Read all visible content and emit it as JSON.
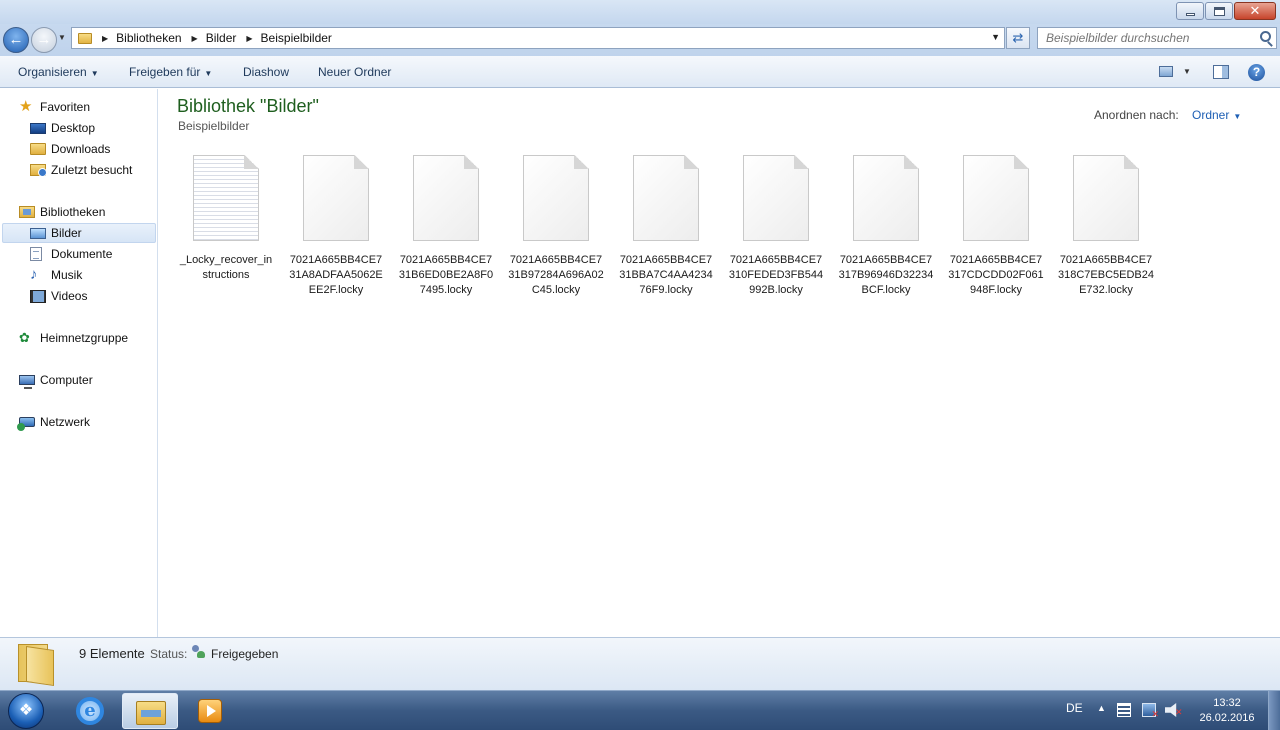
{
  "window": {
    "close_glyph": "✕"
  },
  "address": {
    "breadcrumbs": [
      "Bibliotheken",
      "Bilder",
      "Beispielbilder"
    ],
    "search_placeholder": "Beispielbilder durchsuchen"
  },
  "toolbar": {
    "organize": "Organisieren",
    "share": "Freigeben für",
    "slideshow": "Diashow",
    "new_folder": "Neuer Ordner",
    "help": "?"
  },
  "sidebar": {
    "favorites": "Favoriten",
    "desktop": "Desktop",
    "downloads": "Downloads",
    "recent": "Zuletzt besucht",
    "libraries": "Bibliotheken",
    "pictures": "Bilder",
    "documents": "Dokumente",
    "music": "Musik",
    "videos": "Videos",
    "homegroup": "Heimnetzgruppe",
    "computer": "Computer",
    "network": "Netzwerk"
  },
  "content": {
    "title": "Bibliothek \"Bilder\"",
    "subtitle": "Beispielbilder",
    "arrange_label": "Anordnen nach:",
    "arrange_value": "Ordner",
    "files": [
      {
        "name": "_Locky_recover_instructions",
        "type": "text"
      },
      {
        "name": "7021A665BB4CE731A8ADFAA5062EEE2F.locky",
        "type": "blank"
      },
      {
        "name": "7021A665BB4CE731B6ED0BE2A8F07495.locky",
        "type": "blank"
      },
      {
        "name": "7021A665BB4CE731B97284A696A02C45.locky",
        "type": "blank"
      },
      {
        "name": "7021A665BB4CE731BBA7C4AA423476F9.locky",
        "type": "blank"
      },
      {
        "name": "7021A665BB4CE7310FEDED3FB544992B.locky",
        "type": "blank"
      },
      {
        "name": "7021A665BB4CE7317B96946D32234BCF.locky",
        "type": "blank"
      },
      {
        "name": "7021A665BB4CE7317CDCDD02F061948F.locky",
        "type": "blank"
      },
      {
        "name": "7021A665BB4CE7318C7EBC5EDB24E732.locky",
        "type": "blank"
      }
    ]
  },
  "details": {
    "count": "9 Elemente",
    "status_label": "Status:",
    "status_value": "Freigegeben"
  },
  "taskbar": {
    "language": "DE",
    "time": "13:32",
    "date": "26.02.2016"
  }
}
